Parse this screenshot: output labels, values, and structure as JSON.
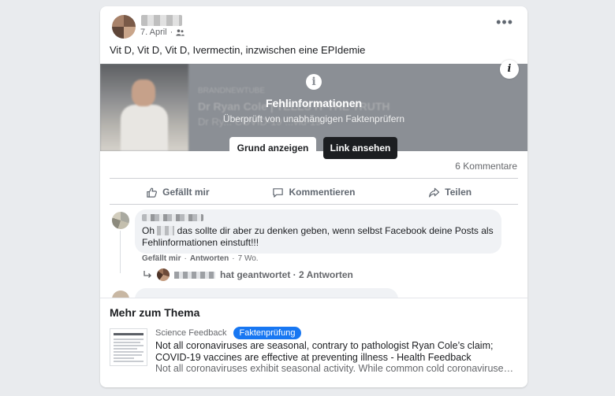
{
  "post": {
    "date": "7. April",
    "audience_icon": "friends-icon",
    "text": "Vit D, Vit D, Vit D, Ivermectin, inzwischen eine EPIdemie"
  },
  "media": {
    "blurred_source": "BRANDNEWTUBE",
    "blurred_title": "Dr Ryan Cole | TELLS IT THE TRUTH",
    "blurred_desc": "Dr Ry... COVID-19 ...vid-19",
    "misinfo_title": "Fehlinformationen",
    "misinfo_subtitle": "Überprüft von unabhängigen Faktenprüfern",
    "reason_button": "Grund anzeigen",
    "link_button": "Link ansehen"
  },
  "stats": {
    "comments": "6 Kommentare"
  },
  "actions": {
    "like": "Gefällt mir",
    "comment": "Kommentieren",
    "share": "Teilen"
  },
  "comment": {
    "text_before": "Oh ",
    "text_after": " das sollte dir aber zu denken geben, wenn selbst Facebook deine Posts als Fehlinformationen einstuft!!!",
    "like": "Gefällt mir",
    "sep1": "·",
    "reply": "Antworten",
    "sep2": "·",
    "age": "7 Wo.",
    "reply_summary": "hat geantwortet · 2 Antworten"
  },
  "more": {
    "title": "Mehr zum Thema",
    "source": "Science Feedback",
    "badge": "Faktenprüfung",
    "article_title": "Not all coronaviruses are seasonal, contrary to pathologist Ryan Cole’s claim; COVID-19 vaccines are effective at preventing illness - Health Feedback",
    "article_desc": "Not all coronaviruses exhibit seasonal activity. While common cold coronaviruses ..."
  }
}
